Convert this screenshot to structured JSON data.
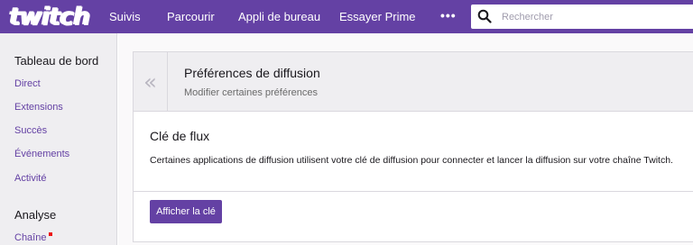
{
  "topbar": {
    "logo_text": "twitch",
    "nav": [
      "Suivis",
      "Parcourir",
      "Appli de bureau",
      "Essayer Prime"
    ],
    "more_label": "•••",
    "search_placeholder": "Rechercher"
  },
  "sidebar": {
    "dashboard_heading": "Tableau de bord",
    "dashboard_items": [
      "Direct",
      "Extensions",
      "Succès",
      "Événements",
      "Activité"
    ],
    "analytics_heading": "Analyse",
    "analytics_items": [
      "Chaîne"
    ]
  },
  "header": {
    "title": "Préférences de diffusion",
    "subtitle": "Modifier certaines préférences",
    "collapse_icon": "«"
  },
  "stream_key": {
    "title": "Clé de flux",
    "description": "Certaines applications de diffusion utilisent votre clé de diffusion pour connecter et lancer la diffusion sur votre chaîne Twitch.",
    "show_button": "Afficher la clé"
  },
  "colors": {
    "brand": "#6441a4",
    "notification_dot": "#ec1313"
  }
}
